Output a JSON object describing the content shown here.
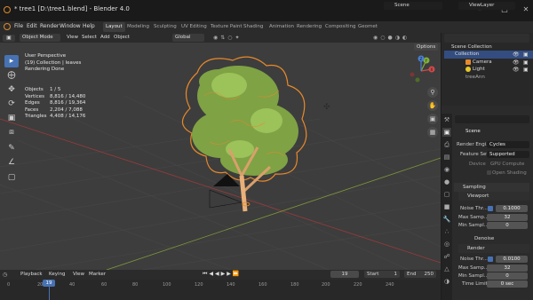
{
  "titlebar": {
    "title": "* tree1 [D:\\tree1.blend] - Blender 4.0"
  },
  "menu": {
    "items": [
      "File",
      "Edit",
      "Render",
      "Window",
      "Help"
    ]
  },
  "workspaces": [
    "Layout",
    "Modeling",
    "Sculpting",
    "UV Editing",
    "Texture Paint",
    "Shading",
    "Animation",
    "Rendering",
    "Compositing",
    "Geomet"
  ],
  "scene_field": "Scene",
  "view_layer_field": "ViewLayer",
  "viewport_header": {
    "mode": "Object Mode",
    "menus": [
      "View",
      "Select",
      "Add",
      "Object"
    ],
    "orientation": "Global",
    "options": "Options"
  },
  "overlay": {
    "view": "User Perspective",
    "collection": "(19) Collection | leaves",
    "status": "Rendering Done"
  },
  "stats": [
    {
      "label": "Objects",
      "value": "1 / 5"
    },
    {
      "label": "Vertices",
      "value": "8,816 / 14,480"
    },
    {
      "label": "Edges",
      "value": "8,816 / 19,364"
    },
    {
      "label": "Faces",
      "value": "2,204 / 7,088"
    },
    {
      "label": "Triangles",
      "value": "4,408 / 14,176"
    }
  ],
  "gizmo": {
    "x": "X",
    "y": "Y",
    "z": "Z"
  },
  "outliner": {
    "root": "Scene Collection",
    "collection": "Collection",
    "items": [
      "Camera",
      "Light",
      "treeAnn"
    ]
  },
  "properties": {
    "scene": "Scene",
    "render_engine_label": "Render Engi...",
    "render_engine": "Cycles",
    "feature_set_label": "Feature Set",
    "feature_set": "Supported",
    "device_label": "Device",
    "device": "GPU Compute",
    "open_shading": "Open Shading",
    "sampling": "Sampling",
    "viewport": "Viewport",
    "noise_thr_label": "Noise Thr...",
    "viewport_noise": "0.1000",
    "max_samples_label": "Max Samp...",
    "viewport_max": "32",
    "min_samples_label": "Min Sampl...",
    "viewport_min": "0",
    "denoise": "Denoise",
    "render": "Render",
    "render_noise": "0.0100",
    "render_max": "32",
    "render_min": "0",
    "time_limit_label": "Time Limit",
    "time_limit": "0 sec"
  },
  "timeline": {
    "menus": [
      "Playback",
      "Keying",
      "View",
      "Marker"
    ],
    "current_frame": "19",
    "start_label": "Start",
    "start": "1",
    "end_label": "End",
    "end": "250",
    "ticks": [
      "0",
      "20",
      "40",
      "60",
      "80",
      "100",
      "120",
      "140",
      "160",
      "180",
      "200",
      "220",
      "240"
    ],
    "playhead": "19"
  }
}
